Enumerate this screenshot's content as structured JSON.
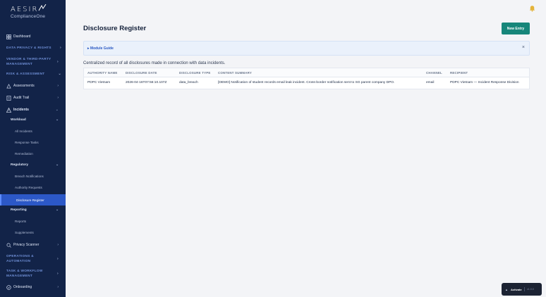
{
  "brand": {
    "name": "AESIR",
    "sub": "ComplianceOne"
  },
  "sidebar": {
    "dashboard": "Dashboard",
    "sections": {
      "data_privacy": "DATA PRIVACY & RIGHTS",
      "vendor": "VENDOR & THIRD-PARTY MANAGEMENT",
      "risk": "RISK & ASSESSMENT",
      "operations": "OPERATIONS & AUTOMATION",
      "task": "TASK & WORKFLOW MANAGEMENT"
    },
    "assessments": "Assessments",
    "audit_trail": "Audit Trail",
    "incidents": "Incidents",
    "workload": "Workload",
    "all_incidents": "All Incidents",
    "response_tasks": "Response Tasks",
    "remediation": "Remediation",
    "regulatory": "Regulatory",
    "breach_notifications": "Breach Notifications",
    "authority_requests": "Authority Requests",
    "disclosure_register": "Disclosure Register",
    "reporting": "Reporting",
    "reports": "Reports",
    "supplements": "Supplements",
    "privacy_scanner": "Privacy Scanner",
    "onboarding": "Onboarding"
  },
  "page": {
    "title": "Disclosure Register",
    "new_entry": "New Entry",
    "guide_label": "Module Guide",
    "description": "Centralized record of all disclosures made in connection with data incidents."
  },
  "table": {
    "headers": [
      "AUTHORITY NAME",
      "DISCLOSURE DATE",
      "DISCLOSURE TYPE",
      "CONTENT SUMMARY",
      "CHANNEL",
      "RECIPIENT"
    ],
    "rows": [
      [
        "PDPC Vietnam",
        "2026-04-16T07:56:10.107Z",
        "data_breach",
        "[DEMO] Notification of student records email leak incident. Cross-border notification sent to SG parent company DPO.",
        "email",
        "PDPC Vietnam — Incident Response Division"
      ]
    ]
  },
  "widget": {
    "action": "Activate",
    "version": "v1.0.0"
  }
}
